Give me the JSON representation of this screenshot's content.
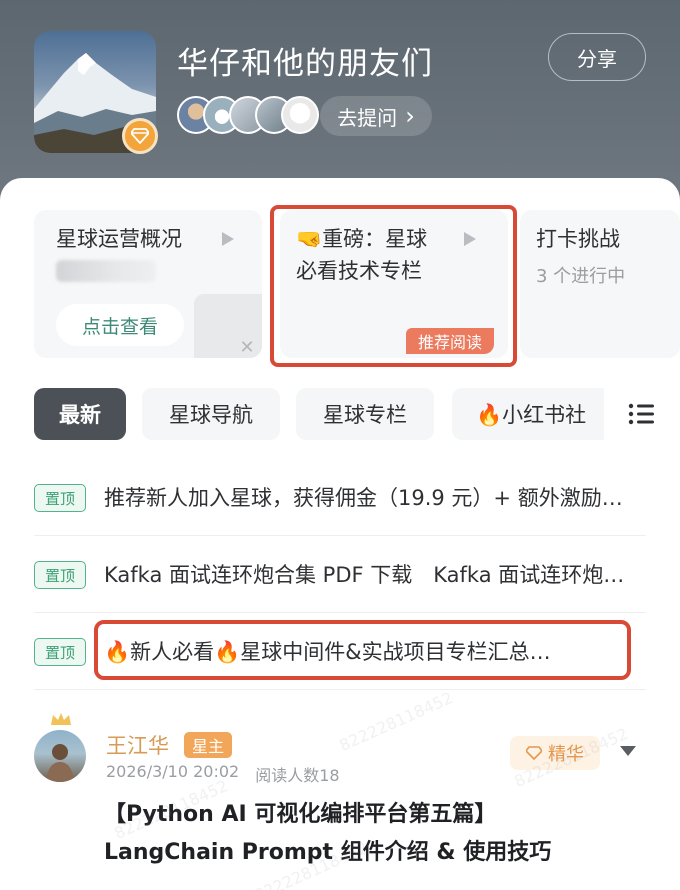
{
  "header": {
    "group_title": "华仔和他的朋友们",
    "share_label": "分享",
    "ask_label": "去提问",
    "ask_chevron": "›"
  },
  "cards": [
    {
      "title": "星球运营概况",
      "button_label": "点击查看"
    },
    {
      "title_line1": "🤜重磅：星球",
      "title_line2": "必看技术专栏",
      "tag": "推荐阅读"
    },
    {
      "title": "打卡挑战",
      "subtitle": "3 个进行中"
    }
  ],
  "tabs": [
    "最新",
    "星球导航",
    "星球专栏",
    "🔥小红书社"
  ],
  "pinned_label": "置顶",
  "pinned": [
    "推荐新人加入星球，获得佣金（19.9 元）+ 额外激励…",
    "Kafka 面试连环炮合集 PDF 下载　Kafka 面试连环炮…",
    "🔥新人必看🔥星球中间件&实战项目专栏汇总…"
  ],
  "post": {
    "author": "王江华",
    "role_tag": "星主",
    "date": "2026/3/10 20:02",
    "readers": "阅读人数18",
    "elite_label": "精华",
    "title_line1": "【Python AI 可视化编排平台第五篇】",
    "title_line2": "LangChain Prompt 组件介绍 & 使用技巧"
  },
  "watermark": "822228118452",
  "colors": {
    "header_bg": "#5d6770",
    "highlight_border": "#d84a35",
    "pinned_tag": "#3da177",
    "recommend_tag": "#eb7a5f",
    "author": "#d79b55"
  }
}
